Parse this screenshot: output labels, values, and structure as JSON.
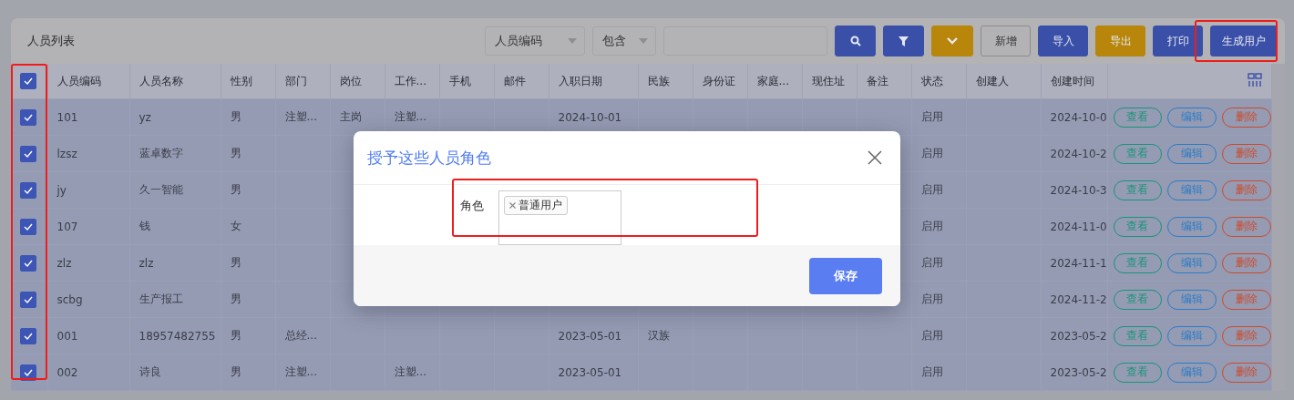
{
  "page_title": "人员列表",
  "toolbar": {
    "field_select": "人员编码",
    "operator_select": "包含",
    "buttons": [
      {
        "label": "新增",
        "kind": "plain"
      },
      {
        "label": "导入",
        "kind": "primary"
      },
      {
        "label": "导出",
        "kind": "warning"
      },
      {
        "label": "打印",
        "kind": "primary"
      },
      {
        "label": "生成用户",
        "kind": "primary"
      }
    ]
  },
  "table": {
    "header_checked": true,
    "columns": [
      "人员编码",
      "人员名称",
      "性别",
      "部门",
      "岗位",
      "工作...",
      "手机",
      "邮件",
      "入职日期",
      "民族",
      "身份证",
      "家庭...",
      "现住址",
      "备注",
      "状态",
      "创建人",
      "创建时间"
    ],
    "rows": [
      {
        "selected": true,
        "cells": [
          "101",
          "yz",
          "男",
          "注塑...",
          "主岗",
          "注塑...",
          null,
          null,
          "2024-10-01",
          null,
          null,
          null,
          null,
          null,
          "启用",
          null,
          "2024-10-0"
        ],
        "actions": [
          "查看",
          "编辑",
          "删除"
        ]
      },
      {
        "selected": true,
        "cells": [
          "lzsz",
          "蓝卓数字",
          "男",
          null,
          null,
          null,
          null,
          null,
          null,
          null,
          null,
          null,
          null,
          null,
          "启用",
          null,
          "2024-10-2"
        ],
        "actions": [
          "查看",
          "编辑",
          "删除"
        ]
      },
      {
        "selected": true,
        "cells": [
          "jy",
          "久一智能",
          "男",
          null,
          null,
          null,
          null,
          null,
          null,
          null,
          null,
          null,
          null,
          null,
          "启用",
          null,
          "2024-10-3"
        ],
        "actions": [
          "查看",
          "编辑",
          "删除"
        ]
      },
      {
        "selected": true,
        "cells": [
          "107",
          "钱",
          "女",
          null,
          null,
          null,
          null,
          null,
          null,
          null,
          null,
          null,
          null,
          null,
          "启用",
          null,
          "2024-11-0"
        ],
        "actions": [
          "查看",
          "编辑",
          "删除"
        ]
      },
      {
        "selected": true,
        "cells": [
          "zlz",
          "zlz",
          "男",
          null,
          null,
          null,
          null,
          null,
          null,
          null,
          null,
          null,
          null,
          null,
          "启用",
          null,
          "2024-11-1"
        ],
        "actions": [
          "查看",
          "编辑",
          "删除"
        ]
      },
      {
        "selected": true,
        "cells": [
          "scbg",
          "生产报工",
          "男",
          null,
          null,
          null,
          null,
          null,
          null,
          null,
          null,
          null,
          null,
          null,
          "启用",
          null,
          "2024-11-2"
        ],
        "actions": [
          "查看",
          "编辑",
          "删除"
        ]
      },
      {
        "selected": true,
        "cells": [
          "001",
          "18957482755",
          "男",
          "总经...",
          null,
          null,
          null,
          null,
          "2023-05-01",
          "汉族",
          null,
          null,
          null,
          null,
          "启用",
          null,
          "2023-05-2"
        ],
        "actions": [
          "查看",
          "编辑",
          "删除"
        ]
      },
      {
        "selected": true,
        "cells": [
          "002",
          "诗良",
          "男",
          "注塑...",
          null,
          "注塑...",
          null,
          null,
          "2023-05-01",
          null,
          null,
          null,
          null,
          null,
          "启用",
          null,
          "2023-05-2"
        ],
        "actions": [
          "查看",
          "编辑",
          "删除"
        ]
      }
    ]
  },
  "modal": {
    "title": "授予这些人员角色",
    "field_label": "角色",
    "tags": [
      {
        "label": "普通用户"
      }
    ],
    "save_button": "保存"
  }
}
